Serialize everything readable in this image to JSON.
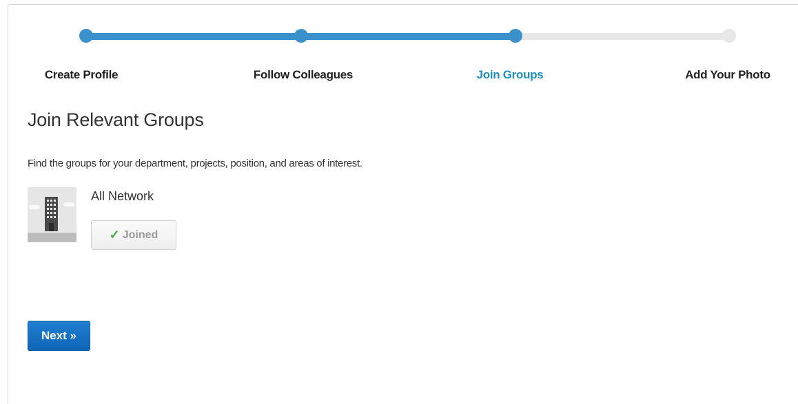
{
  "steps": [
    {
      "label": "Create Profile",
      "state": "done"
    },
    {
      "label": "Follow Colleagues",
      "state": "done"
    },
    {
      "label": "Join Groups",
      "state": "active"
    },
    {
      "label": "Add Your Photo",
      "state": "todo"
    }
  ],
  "progress": {
    "completed_fraction": 0.667
  },
  "colors": {
    "accent": "#3a91cc",
    "active_label": "#1f8fc0",
    "primary_button": "#1670c6",
    "check": "#3ea83e"
  },
  "main": {
    "title": "Join Relevant Groups",
    "description": "Find the groups for your department, projects, position, and areas of interest."
  },
  "groups": [
    {
      "name": "All Network",
      "icon": "building-icon",
      "button_label": "Joined",
      "button_icon": "✓"
    }
  ],
  "footer": {
    "next_label": "Next »"
  }
}
